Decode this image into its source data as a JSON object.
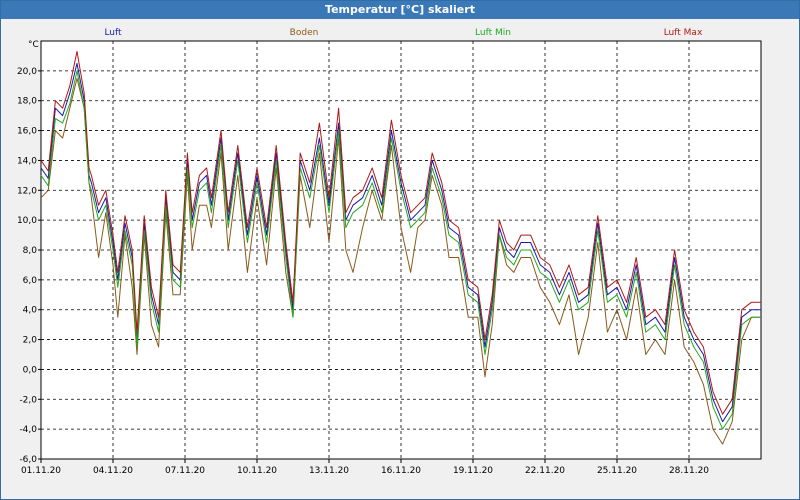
{
  "window": {
    "title": "Temperatur [°C] skaliert"
  },
  "chart_data": {
    "type": "line",
    "title": "Temperatur [°C] skaliert",
    "ylabel": "°C",
    "xlabel": "",
    "ylim": [
      -6.0,
      22.0
    ],
    "xlim": [
      0,
      30
    ],
    "grid": true,
    "legend_position": "top",
    "y_ticks": [
      "-6,0",
      "-4,0",
      "-2,0",
      "0,0",
      "2,0",
      "4,0",
      "6,0",
      "8,0",
      "10,0",
      "12,0",
      "14,0",
      "16,0",
      "18,0",
      "20,0"
    ],
    "x_tick_values": [
      0,
      3,
      6,
      9,
      12,
      15,
      18,
      21,
      24,
      27
    ],
    "x_ticks": [
      "01.11.20",
      "04.11.20",
      "07.11.20",
      "10.11.20",
      "13.11.20",
      "16.11.20",
      "19.11.20",
      "22.11.20",
      "25.11.20",
      "28.11.20"
    ],
    "series": [
      {
        "name": "Luft",
        "color": "#1a1aa8",
        "x": [
          0,
          0.3,
          0.6,
          0.9,
          1.2,
          1.5,
          1.8,
          2.0,
          2.1,
          2.4,
          2.7,
          3.0,
          3.2,
          3.5,
          3.8,
          4.0,
          4.3,
          4.6,
          4.9,
          5.2,
          5.5,
          5.8,
          6.1,
          6.3,
          6.6,
          6.9,
          7.1,
          7.5,
          7.8,
          8.2,
          8.6,
          9.0,
          9.4,
          9.8,
          10.2,
          10.5,
          10.8,
          11.2,
          11.6,
          12.0,
          12.4,
          12.7,
          13.0,
          13.4,
          13.8,
          14.2,
          14.6,
          15.0,
          15.4,
          15.7,
          16.0,
          16.3,
          16.7,
          17.0,
          17.4,
          17.8,
          18.2,
          18.5,
          18.8,
          19.1,
          19.4,
          19.7,
          20.0,
          20.4,
          20.8,
          21.2,
          21.6,
          22.0,
          22.4,
          22.8,
          23.2,
          23.6,
          24.0,
          24.4,
          24.8,
          25.2,
          25.6,
          26.0,
          26.4,
          26.8,
          27.2,
          27.6,
          28.0,
          28.4,
          28.8,
          29.2,
          29.6,
          30.0
        ],
        "values": [
          13.5,
          12.8,
          17.5,
          17.0,
          18.5,
          20.5,
          18.0,
          13.0,
          12.5,
          10.5,
          11.5,
          8.5,
          6.0,
          9.8,
          7.5,
          2.0,
          9.8,
          5.0,
          3.0,
          11.5,
          6.5,
          6.0,
          14.0,
          10.0,
          12.5,
          13.0,
          11.0,
          15.5,
          10.0,
          14.5,
          9.0,
          13.0,
          9.0,
          14.5,
          8.0,
          4.0,
          14.0,
          12.0,
          15.5,
          11.0,
          16.5,
          10.0,
          11.0,
          11.5,
          13.0,
          11.0,
          16.0,
          12.5,
          10.0,
          10.5,
          11.0,
          14.0,
          12.0,
          9.5,
          9.0,
          5.5,
          5.0,
          1.5,
          4.5,
          9.5,
          8.0,
          7.5,
          8.5,
          8.5,
          7.0,
          6.5,
          5.0,
          6.5,
          4.5,
          5.0,
          9.8,
          5.0,
          5.5,
          4.0,
          7.0,
          3.0,
          3.5,
          2.5,
          7.5,
          3.5,
          2.0,
          1.0,
          -2.0,
          -3.5,
          -2.5,
          3.5,
          4.0,
          4.0
        ]
      },
      {
        "name": "Boden",
        "color": "#8b5a1a",
        "x": [
          0,
          0.3,
          0.6,
          0.9,
          1.2,
          1.5,
          1.8,
          2.0,
          2.1,
          2.4,
          2.7,
          3.0,
          3.2,
          3.5,
          3.8,
          4.0,
          4.3,
          4.6,
          4.9,
          5.2,
          5.5,
          5.8,
          6.1,
          6.3,
          6.6,
          6.9,
          7.1,
          7.5,
          7.8,
          8.2,
          8.6,
          9.0,
          9.4,
          9.8,
          10.2,
          10.5,
          10.8,
          11.2,
          11.6,
          12.0,
          12.4,
          12.7,
          13.0,
          13.4,
          13.8,
          14.2,
          14.6,
          15.0,
          15.4,
          15.7,
          16.0,
          16.3,
          16.7,
          17.0,
          17.4,
          17.8,
          18.2,
          18.5,
          18.8,
          19.1,
          19.4,
          19.7,
          20.0,
          20.4,
          20.8,
          21.2,
          21.6,
          22.0,
          22.4,
          22.8,
          23.2,
          23.6,
          24.0,
          24.4,
          24.8,
          25.2,
          25.6,
          26.0,
          26.4,
          26.8,
          27.2,
          27.6,
          28.0,
          28.4,
          28.8,
          29.2,
          29.6,
          30.0
        ],
        "values": [
          11.5,
          12.0,
          16.0,
          15.5,
          17.5,
          19.5,
          17.5,
          12.5,
          11.5,
          7.5,
          10.5,
          7.0,
          3.5,
          9.0,
          5.5,
          1.0,
          9.0,
          3.0,
          1.5,
          10.5,
          5.0,
          5.0,
          13.0,
          8.0,
          11.0,
          11.0,
          9.5,
          14.5,
          8.0,
          13.0,
          6.5,
          11.5,
          7.0,
          13.5,
          6.5,
          3.5,
          13.0,
          9.5,
          14.5,
          8.5,
          15.5,
          8.0,
          6.5,
          9.5,
          12.0,
          10.0,
          15.0,
          9.5,
          6.5,
          9.5,
          10.0,
          13.0,
          11.0,
          7.5,
          7.5,
          3.5,
          3.5,
          -0.5,
          3.0,
          9.0,
          7.0,
          6.5,
          7.5,
          7.5,
          5.5,
          4.5,
          3.0,
          5.0,
          1.0,
          3.5,
          8.5,
          2.5,
          4.0,
          2.0,
          5.5,
          1.0,
          2.0,
          1.0,
          6.0,
          1.5,
          0.5,
          -1.0,
          -4.0,
          -5.0,
          -3.5,
          2.0,
          3.5,
          3.5
        ]
      },
      {
        "name": "Luft Min",
        "color": "#22aa22",
        "x": [
          0,
          0.3,
          0.6,
          0.9,
          1.2,
          1.5,
          1.8,
          2.0,
          2.1,
          2.4,
          2.7,
          3.0,
          3.2,
          3.5,
          3.8,
          4.0,
          4.3,
          4.6,
          4.9,
          5.2,
          5.5,
          5.8,
          6.1,
          6.3,
          6.6,
          6.9,
          7.1,
          7.5,
          7.8,
          8.2,
          8.6,
          9.0,
          9.4,
          9.8,
          10.2,
          10.5,
          10.8,
          11.2,
          11.6,
          12.0,
          12.4,
          12.7,
          13.0,
          13.4,
          13.8,
          14.2,
          14.6,
          15.0,
          15.4,
          15.7,
          16.0,
          16.3,
          16.7,
          17.0,
          17.4,
          17.8,
          18.2,
          18.5,
          18.8,
          19.1,
          19.4,
          19.7,
          20.0,
          20.4,
          20.8,
          21.2,
          21.6,
          22.0,
          22.4,
          22.8,
          23.2,
          23.6,
          24.0,
          24.4,
          24.8,
          25.2,
          25.6,
          26.0,
          26.4,
          26.8,
          27.2,
          27.6,
          28.0,
          28.4,
          28.8,
          29.2,
          29.6,
          30.0
        ],
        "values": [
          13.0,
          12.3,
          16.8,
          16.5,
          17.8,
          20.0,
          17.5,
          12.5,
          12.0,
          10.0,
          11.0,
          8.0,
          5.5,
          9.3,
          7.0,
          1.5,
          9.3,
          4.5,
          2.5,
          11.0,
          6.0,
          5.5,
          13.5,
          9.5,
          12.0,
          12.5,
          10.5,
          15.0,
          9.5,
          14.0,
          8.5,
          12.5,
          8.5,
          14.0,
          7.5,
          3.5,
          13.5,
          11.5,
          15.0,
          10.5,
          16.0,
          9.5,
          10.5,
          11.0,
          12.5,
          10.5,
          15.5,
          12.0,
          9.5,
          10.0,
          10.5,
          13.5,
          11.5,
          9.0,
          8.5,
          5.0,
          4.5,
          1.0,
          4.0,
          9.0,
          7.5,
          7.0,
          8.0,
          8.0,
          6.5,
          6.0,
          4.5,
          6.0,
          4.0,
          4.5,
          9.3,
          4.5,
          5.0,
          3.5,
          6.5,
          2.5,
          3.0,
          2.0,
          7.0,
          3.0,
          1.5,
          0.5,
          -2.5,
          -4.0,
          -3.0,
          3.0,
          3.5,
          3.5
        ]
      },
      {
        "name": "Luft Max",
        "color": "#b01818",
        "x": [
          0,
          0.3,
          0.6,
          0.9,
          1.2,
          1.5,
          1.8,
          2.0,
          2.1,
          2.4,
          2.7,
          3.0,
          3.2,
          3.5,
          3.8,
          4.0,
          4.3,
          4.6,
          4.9,
          5.2,
          5.5,
          5.8,
          6.1,
          6.3,
          6.6,
          6.9,
          7.1,
          7.5,
          7.8,
          8.2,
          8.6,
          9.0,
          9.4,
          9.8,
          10.2,
          10.5,
          10.8,
          11.2,
          11.6,
          12.0,
          12.4,
          12.7,
          13.0,
          13.4,
          13.8,
          14.2,
          14.6,
          15.0,
          15.4,
          15.7,
          16.0,
          16.3,
          16.7,
          17.0,
          17.4,
          17.8,
          18.2,
          18.5,
          18.8,
          19.1,
          19.4,
          19.7,
          20.0,
          20.4,
          20.8,
          21.2,
          21.6,
          22.0,
          22.4,
          22.8,
          23.2,
          23.6,
          24.0,
          24.4,
          24.8,
          25.2,
          25.6,
          26.0,
          26.4,
          26.8,
          27.2,
          27.6,
          28.0,
          28.4,
          28.8,
          29.2,
          29.6,
          30.0
        ],
        "values": [
          14.0,
          13.3,
          18.0,
          17.5,
          19.0,
          21.3,
          18.5,
          13.5,
          13.0,
          11.0,
          12.0,
          9.0,
          6.5,
          10.3,
          8.0,
          2.5,
          10.3,
          5.5,
          3.5,
          12.0,
          7.0,
          6.5,
          14.5,
          10.5,
          13.0,
          13.5,
          11.5,
          16.0,
          10.5,
          15.0,
          9.5,
          13.5,
          9.5,
          15.0,
          8.5,
          4.5,
          14.5,
          12.5,
          16.5,
          11.5,
          17.5,
          10.5,
          11.5,
          12.0,
          13.5,
          11.5,
          16.7,
          13.0,
          10.5,
          11.0,
          11.5,
          14.5,
          12.5,
          10.0,
          9.5,
          6.0,
          5.5,
          2.0,
          5.0,
          10.0,
          8.5,
          8.0,
          9.0,
          9.0,
          7.5,
          7.0,
          5.5,
          7.0,
          5.0,
          5.5,
          10.3,
          5.5,
          6.0,
          4.5,
          7.5,
          3.5,
          4.0,
          3.0,
          8.0,
          4.0,
          2.5,
          1.5,
          -1.5,
          -3.0,
          -2.0,
          4.0,
          4.5,
          4.5
        ]
      }
    ]
  }
}
